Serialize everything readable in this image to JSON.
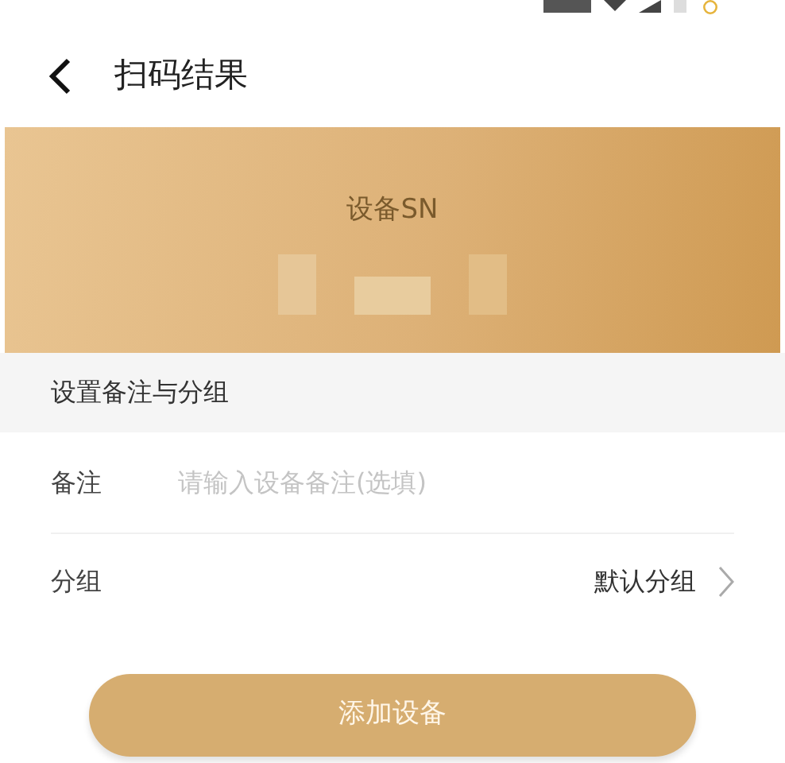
{
  "header": {
    "title": "扫码结果"
  },
  "banner": {
    "label": "设备SN"
  },
  "section": {
    "title": "设置备注与分组"
  },
  "form": {
    "note": {
      "label": "备注",
      "placeholder": "请输入设备备注(选填)"
    },
    "group": {
      "label": "分组",
      "value": "默认分组"
    }
  },
  "button": {
    "label": "添加设备"
  }
}
